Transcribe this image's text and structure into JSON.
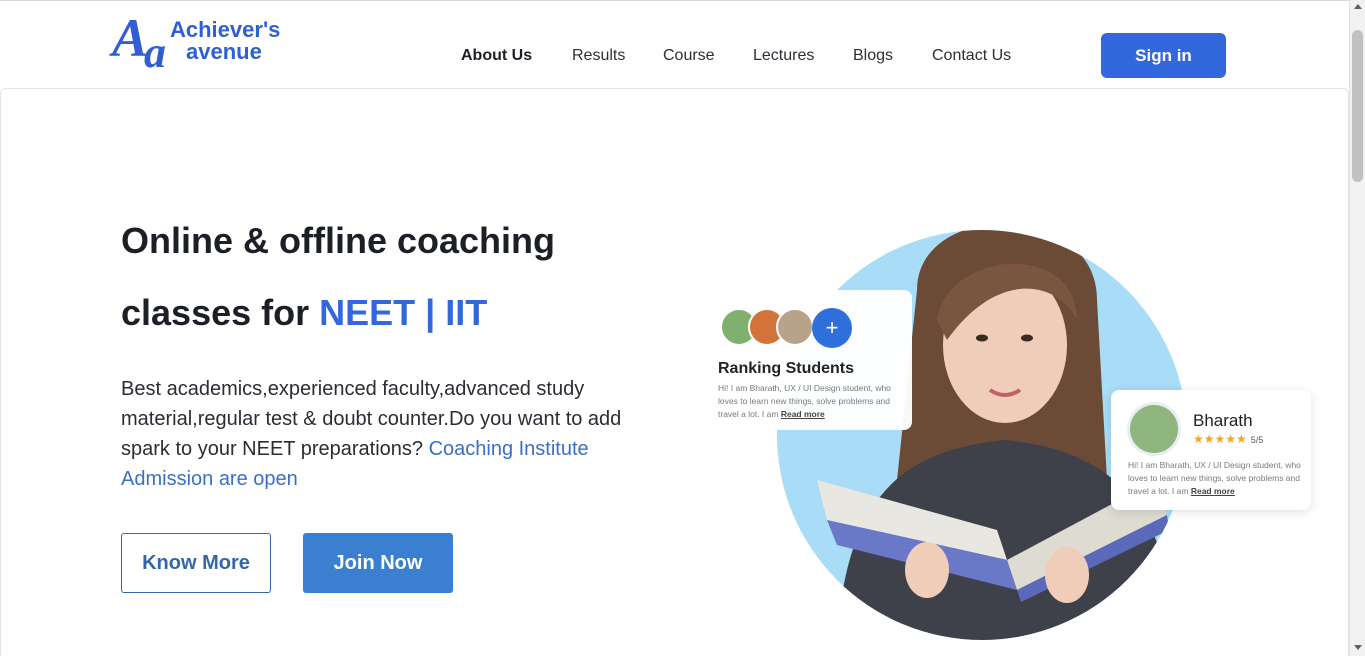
{
  "logo": {
    "mark": "Aa",
    "big_letter": "A",
    "small_letter": "a",
    "line1": "Achiever's",
    "line2": "avenue"
  },
  "nav": {
    "items": [
      {
        "label": "About Us",
        "active": true
      },
      {
        "label": "Results",
        "active": false
      },
      {
        "label": "Course",
        "active": false
      },
      {
        "label": "Lectures",
        "active": false
      },
      {
        "label": "Blogs",
        "active": false
      },
      {
        "label": "Contact Us",
        "active": false
      }
    ],
    "signin_label": "Sign in"
  },
  "hero": {
    "headline_line1": "Online & offline coaching",
    "headline_line2_prefix": "classes for ",
    "headline_accent": "NEET | IIT",
    "description": "Best academics,experienced faculty,advanced study material,regular test & doubt counter.Do you want to add spark to your NEET preparations? ",
    "description_link": "Coaching Institute Admission are open",
    "know_more_label": "Know More",
    "join_now_label": "Join Now"
  },
  "ranking_card": {
    "plus": "+",
    "title": "Ranking Students",
    "text": "Hi! I am Bharath, UX / UI Design student, who loves to learn new things, solve problems and travel a lot. I am ",
    "read_more": "Read more"
  },
  "bharath_card": {
    "name": "Bharath",
    "stars": "★★★★★",
    "rating": "5/5",
    "text": "Hi! I am Bharath, UX / UI Design student, who loves to learn new things, solve problems and travel a lot. I am ",
    "read_more": "Read more"
  },
  "colors": {
    "accent": "#3367dc",
    "join_button": "#3a7fd0",
    "link": "#3b6fc6",
    "circle": "#a9dcf7",
    "star": "#f5a623"
  },
  "icons": {
    "plus": "plus-icon",
    "scroll_up": "scroll-up-icon",
    "scroll_down": "scroll-down-icon"
  }
}
